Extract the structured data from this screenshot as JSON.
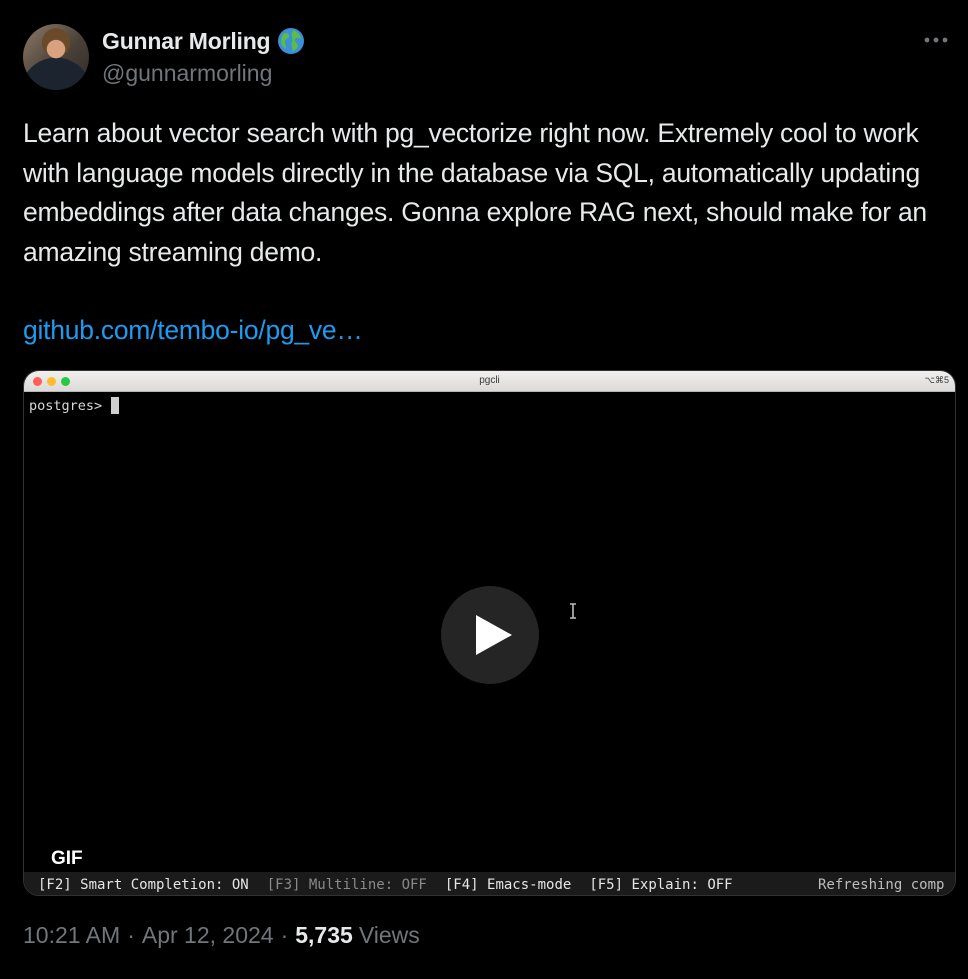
{
  "author": {
    "display_name": "Gunnar Morling",
    "handle": "@gunnarmorling",
    "badge_icon": "globe-icon"
  },
  "more_icon": "more-icon",
  "tweet": {
    "text": "Learn about vector search with pg_vectorize right now. Extremely cool to work with language models directly in the database via SQL, automatically updating embeddings after data changes. Gonna explore RAG next, should make for an amazing streaming demo.",
    "link_text": "github.com/tembo-io/pg_ve…",
    "link_color": "#1d9bf0"
  },
  "media": {
    "window_title": "pgcli",
    "window_shortcut": "⌥⌘5",
    "prompt": "postgres>",
    "gif_badge": "GIF",
    "play_icon": "play-icon",
    "status_bar": {
      "f2": "[F2] Smart Completion: ON",
      "f3": "[F3] Multiline: OFF",
      "f4": "[F4] Emacs-mode",
      "f5": "[F5] Explain: OFF",
      "right": "Refreshing comp"
    }
  },
  "footer": {
    "time": "10:21 AM",
    "separator": "·",
    "date": "Apr 12, 2024",
    "views_count": "5,735",
    "views_label": "Views"
  }
}
